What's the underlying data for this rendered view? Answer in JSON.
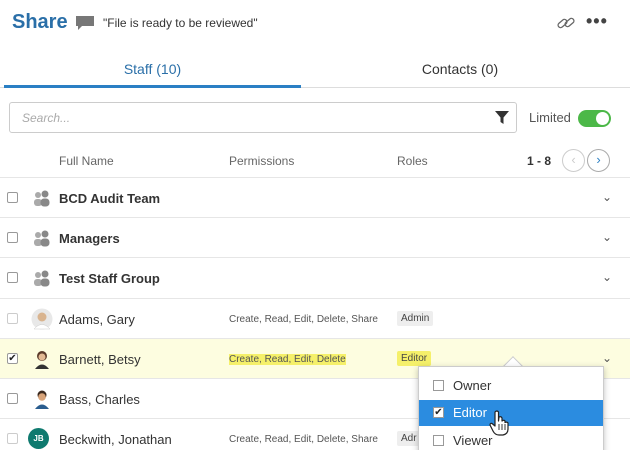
{
  "header": {
    "title": "Share",
    "comment": "\"File is ready to be reviewed\"",
    "more": "•••"
  },
  "tabs": [
    {
      "label": "Staff (10)",
      "active": true
    },
    {
      "label": "Contacts (0)",
      "active": false
    }
  ],
  "search": {
    "placeholder": "Search...",
    "limited_label": "Limited",
    "limited_on": true
  },
  "table": {
    "columns": [
      "Full Name",
      "Permissions",
      "Roles"
    ],
    "pager": "1 - 8",
    "rows": [
      {
        "name": "BCD Audit Team",
        "type": "group",
        "permissions": "",
        "role": "",
        "checked": false
      },
      {
        "name": "Managers",
        "type": "group",
        "permissions": "",
        "role": "",
        "checked": false
      },
      {
        "name": "Test Staff Group",
        "type": "group",
        "permissions": "",
        "role": "",
        "checked": false
      },
      {
        "name": "Adams, Gary",
        "type": "person",
        "permissions": "Create, Read, Edit, Delete, Share",
        "role": "Admin",
        "checked": false
      },
      {
        "name": "Barnett, Betsy",
        "type": "person",
        "permissions": "Create, Read, Edit, Delete",
        "role": "Editor",
        "checked": true
      },
      {
        "name": "Bass, Charles",
        "type": "person",
        "permissions": "",
        "role": "",
        "checked": false
      },
      {
        "name": "Beckwith, Jonathan",
        "type": "person",
        "permissions": "Create, Read, Edit, Delete, Share",
        "role": "Adr",
        "checked": false,
        "initials": "JB"
      }
    ]
  },
  "role_dropdown": {
    "options": [
      {
        "label": "Owner",
        "checked": false
      },
      {
        "label": "Editor",
        "checked": true
      },
      {
        "label": "Viewer",
        "checked": false
      }
    ]
  },
  "colors": {
    "brand": "#2a6fa8",
    "toggle_on": "#4cb848",
    "highlight": "#f5f06a",
    "dropdown_active": "#2b8ce0",
    "avatar_jb": "#0f7a6f"
  }
}
